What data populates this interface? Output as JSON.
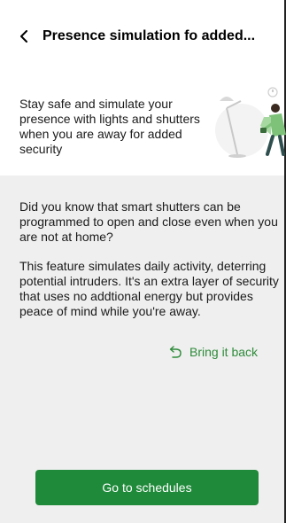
{
  "header": {
    "title": "Presence simulation fo added..."
  },
  "intro": {
    "text": "Stay safe and simulate your presence with lights and shutters when you are away for added security"
  },
  "content": {
    "paragraph1": "Did you know that smart shutters can be programmed to open and close even when you are not at home?",
    "paragraph2": "This feature simulates daily activity, deterring potential intruders. It's an extra layer of security that uses no addtional energy but provides peace of mind while you're away."
  },
  "bring_back": {
    "label": "Bring it back",
    "icon": "arrow-back-icon"
  },
  "primary_button": {
    "label": "Go to schedules"
  },
  "colors": {
    "accent": "#1f8a3a",
    "link": "#2e8b3a",
    "panel": "#efefef"
  }
}
